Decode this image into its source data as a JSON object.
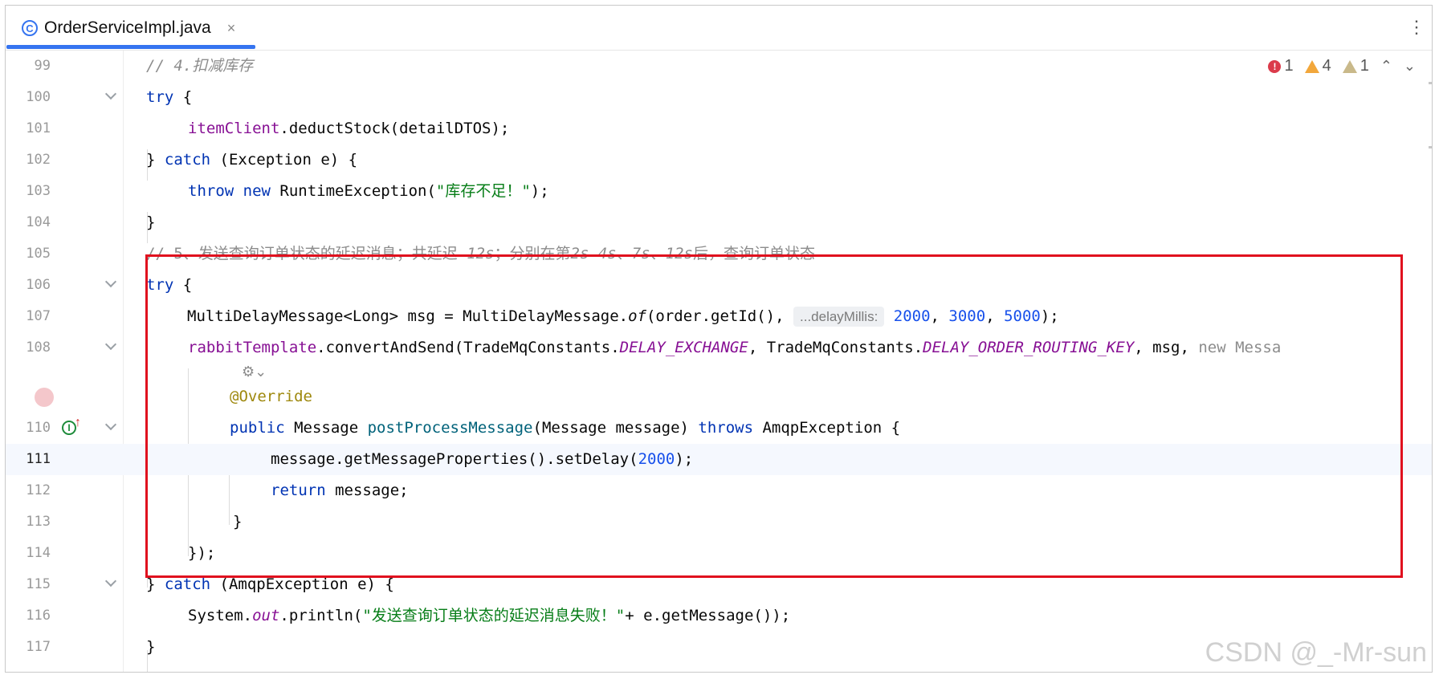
{
  "tab": {
    "icon": "C",
    "title": "OrderServiceImpl.java",
    "close": "×",
    "more": "⋮"
  },
  "inspections": {
    "errors": "1",
    "warnings": "4",
    "weak": "1",
    "up": "⌃",
    "down": "⌄"
  },
  "hint": "...delayMillis:",
  "watermark": "CSDN @_-Mr-sun",
  "gutter": {
    "l99": "99",
    "l100": "100",
    "l101": "101",
    "l102": "102",
    "l103": "103",
    "l104": "104",
    "l105": "105",
    "l106": "106",
    "l107": "107",
    "l108": "108",
    "l110": "110",
    "l111": "111",
    "l112": "112",
    "l113": "113",
    "l114": "114",
    "l115": "115",
    "l116": "116",
    "l117": "117"
  },
  "code": {
    "c99": "// 4.扣减库存",
    "c100_kw": "try",
    "c100_rest": " {",
    "c101_fld": "itemClient",
    "c101_rest": ".deductStock(detailDTOS);",
    "c102_a": "} ",
    "c102_kw": "catch",
    "c102_rest": " (Exception e) {",
    "c103_kw1": "throw",
    "c103_kw2": "new",
    "c103_a": " RuntimeException(",
    "c103_str": "\"库存不足！\"",
    "c103_b": ");",
    "c104": "}",
    "c105_a": "// 5、发送查询订单状态的延迟消息；共延迟 ",
    "c105_b": "12s",
    "c105_c": "；分别在第",
    "c105_d": "2s 4s",
    "c105_e": "、",
    "c105_f": "7s",
    "c105_g": "、",
    "c105_h": "12s",
    "c105_i": "后，查询订单状态",
    "c106_kw": "try",
    "c106_rest": " {",
    "c107_a": "MultiDelayMessage<Long> msg = MultiDelayMessage.",
    "c107_of": "of",
    "c107_b": "(order.getId(), ",
    "c107_n1": "2000",
    "c107_c": ", ",
    "c107_n2": "3000",
    "c107_d": ", ",
    "c107_n3": "5000",
    "c107_e": ");",
    "c108_fld": "rabbitTemplate",
    "c108_a": ".convertAndSend(TradeMqConstants.",
    "c108_c1": "DELAY_EXCHANGE",
    "c108_b": ", TradeMqConstants.",
    "c108_c2": "DELAY_ORDER_ROUTING_KEY",
    "c108_c": ", msg, ",
    "c108_tail": "new Messa",
    "c_override": "@Override",
    "c110_kw": "public",
    "c110_a": " Message ",
    "c110_fn": "postProcessMessage",
    "c110_b": "(Message message) ",
    "c110_kw2": "throws",
    "c110_c": " AmqpException {",
    "c111_a": "message.getMessageProperties().setDelay(",
    "c111_n": "2000",
    "c111_b": ");",
    "c112_kw": "return",
    "c112_rest": " message;",
    "c113": "}",
    "c114": "});",
    "c115_a": "} ",
    "c115_kw": "catch",
    "c115_rest": " (AmqpException e) {",
    "c116_a": "System.",
    "c116_out": "out",
    "c116_b": ".println(",
    "c116_str": "\"发送查询订单状态的延迟消息失败！\"",
    "c116_c": "+ e.getMessage());",
    "c117": "}"
  }
}
